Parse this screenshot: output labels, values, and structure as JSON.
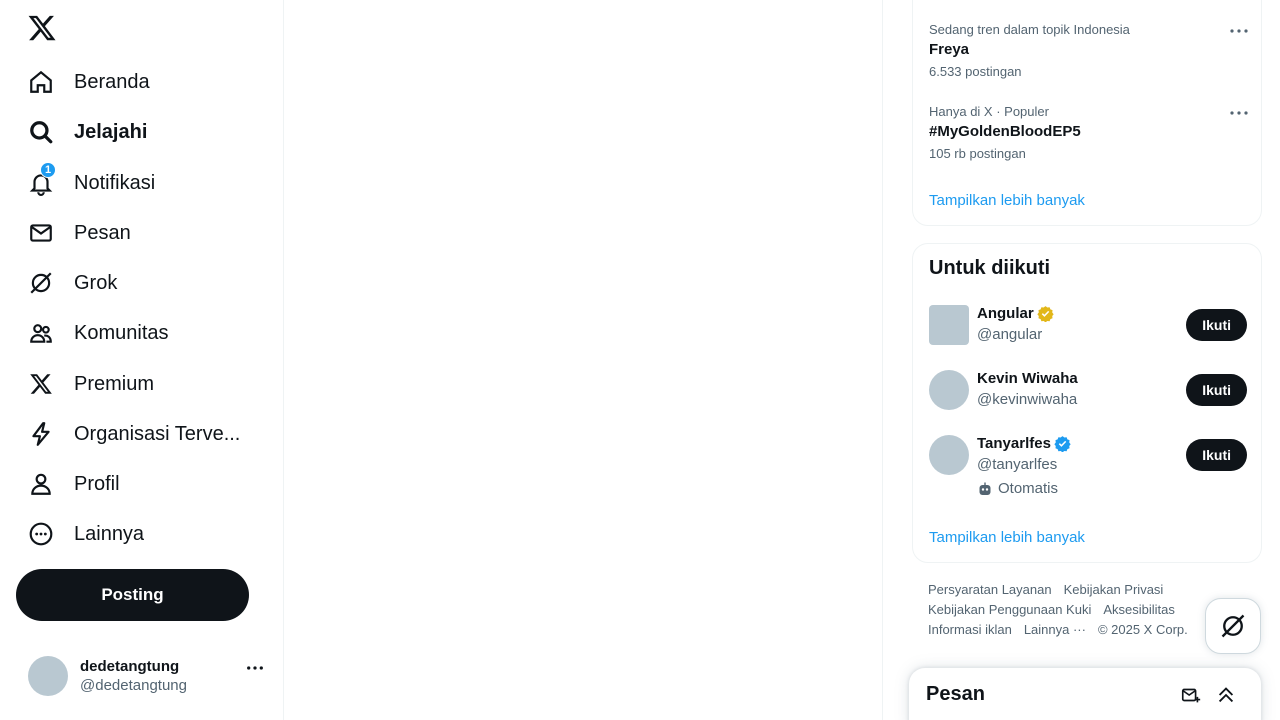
{
  "nav": {
    "items": [
      {
        "label": "Beranda",
        "icon": "home-icon"
      },
      {
        "label": "Jelajahi",
        "icon": "search-icon"
      },
      {
        "label": "Notifikasi",
        "icon": "bell-icon",
        "badge": "1"
      },
      {
        "label": "Pesan",
        "icon": "mail-icon"
      },
      {
        "label": "Grok",
        "icon": "grok-icon"
      },
      {
        "label": "Komunitas",
        "icon": "people-icon"
      },
      {
        "label": "Premium",
        "icon": "x-logo-icon"
      },
      {
        "label": "Organisasi Terve...",
        "icon": "lightning-icon"
      },
      {
        "label": "Profil",
        "icon": "person-icon"
      },
      {
        "label": "Lainnya",
        "icon": "more-circle-icon"
      }
    ],
    "post_button": "Posting"
  },
  "account": {
    "name": "dedetangtung",
    "handle": "@dedetangtung"
  },
  "trends": {
    "items": [
      {
        "meta": "Sedang tren dalam topik Indonesia",
        "title": "Freya",
        "count": "6.533 postingan"
      },
      {
        "meta": "Hanya di X · Populer",
        "title": "#MyGoldenBloodEP5",
        "count": "105 rb postingan"
      }
    ],
    "show_more": "Tampilkan lebih banyak"
  },
  "who_to_follow": {
    "title": "Untuk diikuti",
    "users": [
      {
        "name": "Angular",
        "handle": "@angular",
        "verified": "gold",
        "follow": "Ikuti"
      },
      {
        "name": "Kevin Wiwaha",
        "handle": "@kevinwiwaha",
        "follow": "Ikuti"
      },
      {
        "name": "Tanyarlfes",
        "handle": "@tanyarlfes",
        "verified": "blue",
        "automated": "Otomatis",
        "follow": "Ikuti"
      }
    ],
    "show_more": "Tampilkan lebih banyak"
  },
  "footer": {
    "links": [
      "Persyaratan Layanan",
      "Kebijakan Privasi",
      "Kebijakan Penggunaan Kuki",
      "Aksesibilitas",
      "Informasi iklan",
      "Lainnya ···",
      "© 2025 X Corp."
    ]
  },
  "messages": {
    "title": "Pesan"
  },
  "colors": {
    "accent": "#1d9bf0",
    "text": "#0f1419",
    "muted": "#536471",
    "gold_badge": "#e2b719"
  }
}
